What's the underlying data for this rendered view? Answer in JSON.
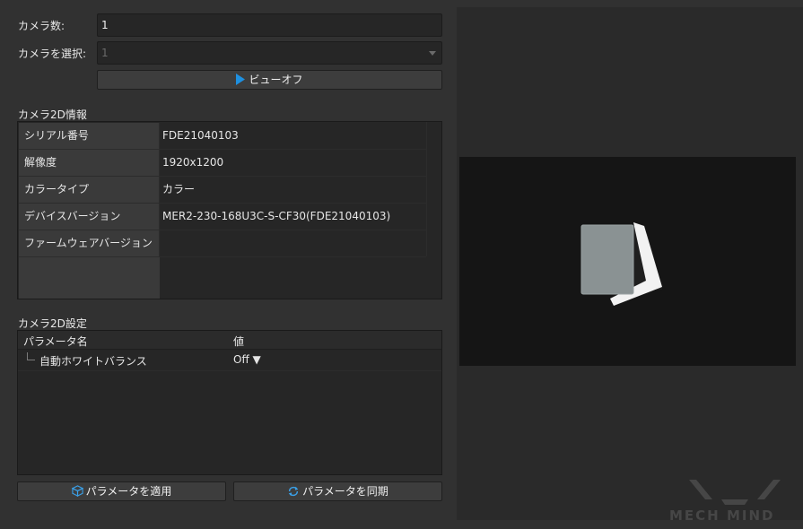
{
  "camera_count": {
    "label": "カメラ数:",
    "value": "1"
  },
  "camera_select": {
    "label": "カメラを選択:",
    "value": "1"
  },
  "view_button": {
    "label": "ビューオフ",
    "icon": "play-icon",
    "icon_color": "#1e90e0"
  },
  "info_section": {
    "title": "カメラ2D情報",
    "rows": [
      {
        "key": "シリアル番号",
        "value": "FDE21040103"
      },
      {
        "key": "解像度",
        "value": "1920x1200"
      },
      {
        "key": "カラータイプ",
        "value": "カラー"
      },
      {
        "key": "デバイスバージョン",
        "value": "MER2-230-168U3C-S-CF30(FDE21040103)"
      },
      {
        "key": "ファームウェアバージョン",
        "value": ""
      }
    ]
  },
  "settings_section": {
    "title": "カメラ2D設定",
    "columns": [
      "パラメータ名",
      "値"
    ],
    "rows": [
      {
        "name": "自動ホワイトバランス",
        "value": "Off ▼"
      }
    ]
  },
  "apply_button": {
    "label": "パラメータを適用",
    "icon": "cube-icon",
    "icon_color": "#3aa0e8"
  },
  "sync_button": {
    "label": "パラメータを同期",
    "icon": "sync-icon",
    "icon_color": "#3aa0e8"
  },
  "watermark": {
    "text": "MECH MIND"
  }
}
